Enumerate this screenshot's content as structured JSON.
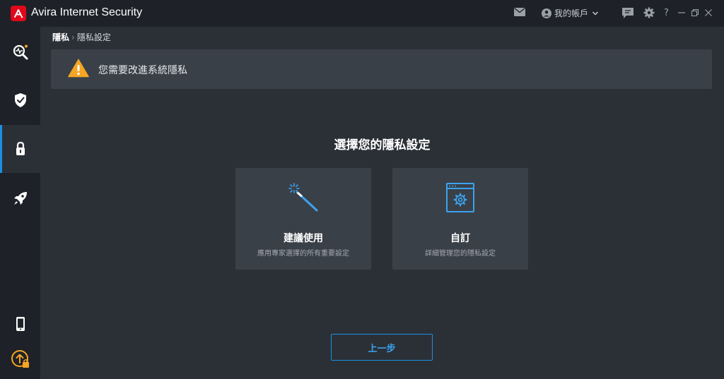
{
  "window": {
    "app_title": "Avira Internet Security",
    "account_label": "我的帳戶",
    "help_label": "?"
  },
  "sidebar": {
    "items": [
      {
        "name": "scan",
        "icon": "scan-pulse-icon"
      },
      {
        "name": "protection",
        "icon": "shield-check-icon"
      },
      {
        "name": "privacy",
        "icon": "lock-icon",
        "active": true
      },
      {
        "name": "performance",
        "icon": "rocket-icon"
      },
      {
        "name": "mobile",
        "icon": "mobile-phone-icon"
      },
      {
        "name": "upgrade",
        "icon": "upgrade-icon"
      }
    ]
  },
  "breadcrumb": {
    "root": "隱私",
    "separator": "›",
    "current": "隱私設定"
  },
  "banner": {
    "icon": "warning-icon",
    "text": "您需要改進系統隱私"
  },
  "main": {
    "title": "選擇您的隱私設定",
    "cards": [
      {
        "icon": "magic-wand-icon",
        "title": "建議使用",
        "desc": "應用專家選擇的所有重要設定"
      },
      {
        "icon": "settings-window-icon",
        "title": "自訂",
        "desc": "詳細管理您的隱私設定"
      }
    ],
    "back_label": "上一步"
  },
  "colors": {
    "accent": "#1a8fe3",
    "brand": "#e2071b",
    "warning": "#f5a623",
    "background": "#2b3037",
    "sidebar": "#1e2228",
    "card": "#3a4048"
  }
}
